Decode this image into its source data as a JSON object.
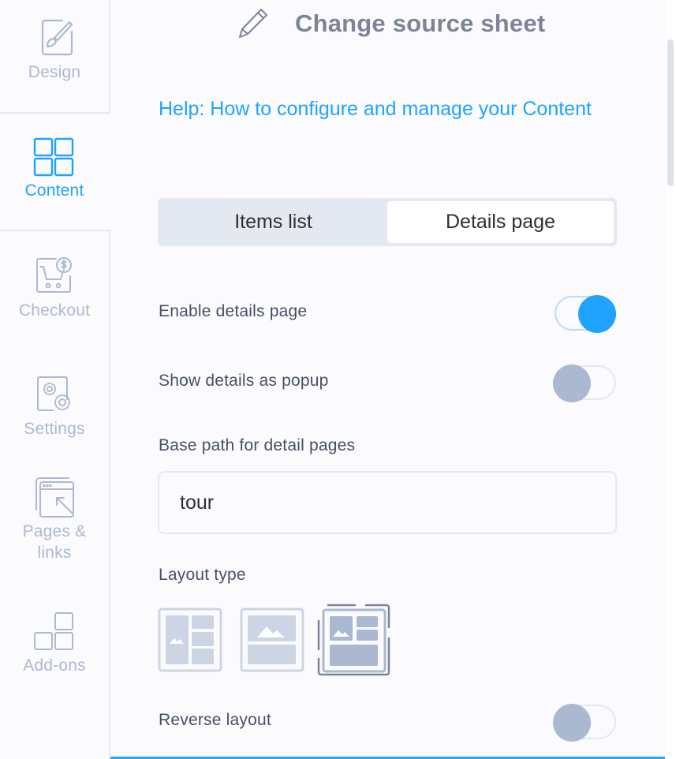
{
  "sidebar": {
    "items": [
      {
        "label": "Design",
        "icon": "paintbrush-icon",
        "active": false
      },
      {
        "label": "Content",
        "icon": "grid-icon",
        "active": true
      },
      {
        "label": "Checkout",
        "icon": "cart-dollar-icon",
        "active": false
      },
      {
        "label": "Settings",
        "icon": "gears-icon",
        "active": false
      },
      {
        "label": "Pages &\nlinks",
        "label_line1": "Pages &",
        "label_line2": "links",
        "icon": "browser-link-icon",
        "active": false
      },
      {
        "label": "Add-ons",
        "icon": "addons-blocks-icon",
        "active": false
      }
    ]
  },
  "header": {
    "title": "Change source sheet",
    "icon": "pencil-icon"
  },
  "help_link": "Help: How to configure and manage your Content",
  "tabs": [
    {
      "label": "Items list",
      "selected": false
    },
    {
      "label": "Details page",
      "selected": true
    }
  ],
  "settings": {
    "enable_details": {
      "label": "Enable details page",
      "value": true
    },
    "show_popup": {
      "label": "Show details as popup",
      "value": false
    },
    "base_path": {
      "label": "Base path for detail pages",
      "value": "tour"
    },
    "layout_type": {
      "label": "Layout type",
      "options": [
        "image-left-sidebar",
        "image-top-stacked",
        "image-grid-split"
      ],
      "selected_index": 2
    },
    "reverse_layout": {
      "label": "Reverse layout",
      "value": false
    }
  },
  "colors": {
    "accent": "#1fa3ff",
    "muted_icon": "#abb9d2",
    "text": "#465063",
    "title": "#7b8597"
  }
}
